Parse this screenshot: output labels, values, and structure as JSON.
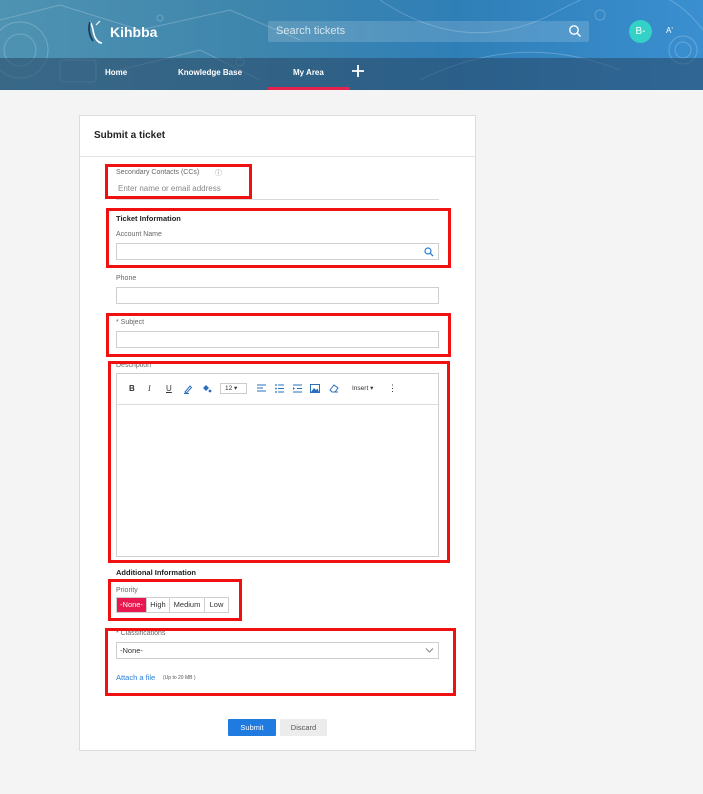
{
  "header": {
    "brand": "Kihbba",
    "search_placeholder": "Search tickets",
    "avatar_initials": "B-",
    "font_toggle": "A'",
    "nav": {
      "home": "Home",
      "knowledge_base": "Knowledge Base",
      "my_area": "My Area"
    },
    "active_tab": "My Area"
  },
  "form": {
    "title": "Submit a ticket",
    "secondary_contacts_label": "Secondary Contacts (CCs)",
    "secondary_contacts_placeholder": "Enter name or email address",
    "ticket_info_heading": "Ticket Information",
    "account_name_label": "Account Name",
    "phone_label": "Phone",
    "subject_label": "* Subject",
    "description_label": "Description",
    "editor_toolbar": {
      "bold": "B",
      "italic": "I",
      "underline": "U",
      "font_size": "12",
      "insert": "Insert"
    },
    "additional_info_heading": "Additional Information",
    "priority_label": "Priority",
    "priority_options": [
      "-None-",
      "High",
      "Medium",
      "Low"
    ],
    "priority_selected": "-None-",
    "classifications_label": "* Classifications",
    "classifications_value": "-None-",
    "attach_link": "Attach a file",
    "attach_note": "(Up to 20 MB )",
    "submit_label": "Submit",
    "discard_label": "Discard"
  },
  "colors": {
    "accent": "#1f7be0",
    "active_tab_underline": "#e5214f",
    "priority_selected_bg": "#e8194e",
    "highlight_box": "#ef1010",
    "avatar_bg": "#34d1c6"
  }
}
